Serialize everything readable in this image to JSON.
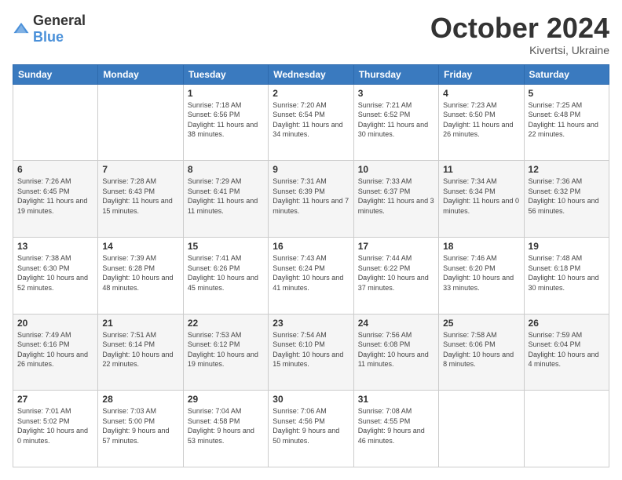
{
  "header": {
    "logo": {
      "text_general": "General",
      "text_blue": "Blue"
    },
    "title": "October 2024",
    "location": "Kivertsi, Ukraine"
  },
  "calendar": {
    "days_of_week": [
      "Sunday",
      "Monday",
      "Tuesday",
      "Wednesday",
      "Thursday",
      "Friday",
      "Saturday"
    ],
    "weeks": [
      [
        {
          "day": "",
          "info": ""
        },
        {
          "day": "",
          "info": ""
        },
        {
          "day": "1",
          "info": "Sunrise: 7:18 AM\nSunset: 6:56 PM\nDaylight: 11 hours and 38 minutes."
        },
        {
          "day": "2",
          "info": "Sunrise: 7:20 AM\nSunset: 6:54 PM\nDaylight: 11 hours and 34 minutes."
        },
        {
          "day": "3",
          "info": "Sunrise: 7:21 AM\nSunset: 6:52 PM\nDaylight: 11 hours and 30 minutes."
        },
        {
          "day": "4",
          "info": "Sunrise: 7:23 AM\nSunset: 6:50 PM\nDaylight: 11 hours and 26 minutes."
        },
        {
          "day": "5",
          "info": "Sunrise: 7:25 AM\nSunset: 6:48 PM\nDaylight: 11 hours and 22 minutes."
        }
      ],
      [
        {
          "day": "6",
          "info": "Sunrise: 7:26 AM\nSunset: 6:45 PM\nDaylight: 11 hours and 19 minutes."
        },
        {
          "day": "7",
          "info": "Sunrise: 7:28 AM\nSunset: 6:43 PM\nDaylight: 11 hours and 15 minutes."
        },
        {
          "day": "8",
          "info": "Sunrise: 7:29 AM\nSunset: 6:41 PM\nDaylight: 11 hours and 11 minutes."
        },
        {
          "day": "9",
          "info": "Sunrise: 7:31 AM\nSunset: 6:39 PM\nDaylight: 11 hours and 7 minutes."
        },
        {
          "day": "10",
          "info": "Sunrise: 7:33 AM\nSunset: 6:37 PM\nDaylight: 11 hours and 3 minutes."
        },
        {
          "day": "11",
          "info": "Sunrise: 7:34 AM\nSunset: 6:34 PM\nDaylight: 11 hours and 0 minutes."
        },
        {
          "day": "12",
          "info": "Sunrise: 7:36 AM\nSunset: 6:32 PM\nDaylight: 10 hours and 56 minutes."
        }
      ],
      [
        {
          "day": "13",
          "info": "Sunrise: 7:38 AM\nSunset: 6:30 PM\nDaylight: 10 hours and 52 minutes."
        },
        {
          "day": "14",
          "info": "Sunrise: 7:39 AM\nSunset: 6:28 PM\nDaylight: 10 hours and 48 minutes."
        },
        {
          "day": "15",
          "info": "Sunrise: 7:41 AM\nSunset: 6:26 PM\nDaylight: 10 hours and 45 minutes."
        },
        {
          "day": "16",
          "info": "Sunrise: 7:43 AM\nSunset: 6:24 PM\nDaylight: 10 hours and 41 minutes."
        },
        {
          "day": "17",
          "info": "Sunrise: 7:44 AM\nSunset: 6:22 PM\nDaylight: 10 hours and 37 minutes."
        },
        {
          "day": "18",
          "info": "Sunrise: 7:46 AM\nSunset: 6:20 PM\nDaylight: 10 hours and 33 minutes."
        },
        {
          "day": "19",
          "info": "Sunrise: 7:48 AM\nSunset: 6:18 PM\nDaylight: 10 hours and 30 minutes."
        }
      ],
      [
        {
          "day": "20",
          "info": "Sunrise: 7:49 AM\nSunset: 6:16 PM\nDaylight: 10 hours and 26 minutes."
        },
        {
          "day": "21",
          "info": "Sunrise: 7:51 AM\nSunset: 6:14 PM\nDaylight: 10 hours and 22 minutes."
        },
        {
          "day": "22",
          "info": "Sunrise: 7:53 AM\nSunset: 6:12 PM\nDaylight: 10 hours and 19 minutes."
        },
        {
          "day": "23",
          "info": "Sunrise: 7:54 AM\nSunset: 6:10 PM\nDaylight: 10 hours and 15 minutes."
        },
        {
          "day": "24",
          "info": "Sunrise: 7:56 AM\nSunset: 6:08 PM\nDaylight: 10 hours and 11 minutes."
        },
        {
          "day": "25",
          "info": "Sunrise: 7:58 AM\nSunset: 6:06 PM\nDaylight: 10 hours and 8 minutes."
        },
        {
          "day": "26",
          "info": "Sunrise: 7:59 AM\nSunset: 6:04 PM\nDaylight: 10 hours and 4 minutes."
        }
      ],
      [
        {
          "day": "27",
          "info": "Sunrise: 7:01 AM\nSunset: 5:02 PM\nDaylight: 10 hours and 0 minutes."
        },
        {
          "day": "28",
          "info": "Sunrise: 7:03 AM\nSunset: 5:00 PM\nDaylight: 9 hours and 57 minutes."
        },
        {
          "day": "29",
          "info": "Sunrise: 7:04 AM\nSunset: 4:58 PM\nDaylight: 9 hours and 53 minutes."
        },
        {
          "day": "30",
          "info": "Sunrise: 7:06 AM\nSunset: 4:56 PM\nDaylight: 9 hours and 50 minutes."
        },
        {
          "day": "31",
          "info": "Sunrise: 7:08 AM\nSunset: 4:55 PM\nDaylight: 9 hours and 46 minutes."
        },
        {
          "day": "",
          "info": ""
        },
        {
          "day": "",
          "info": ""
        }
      ]
    ]
  }
}
